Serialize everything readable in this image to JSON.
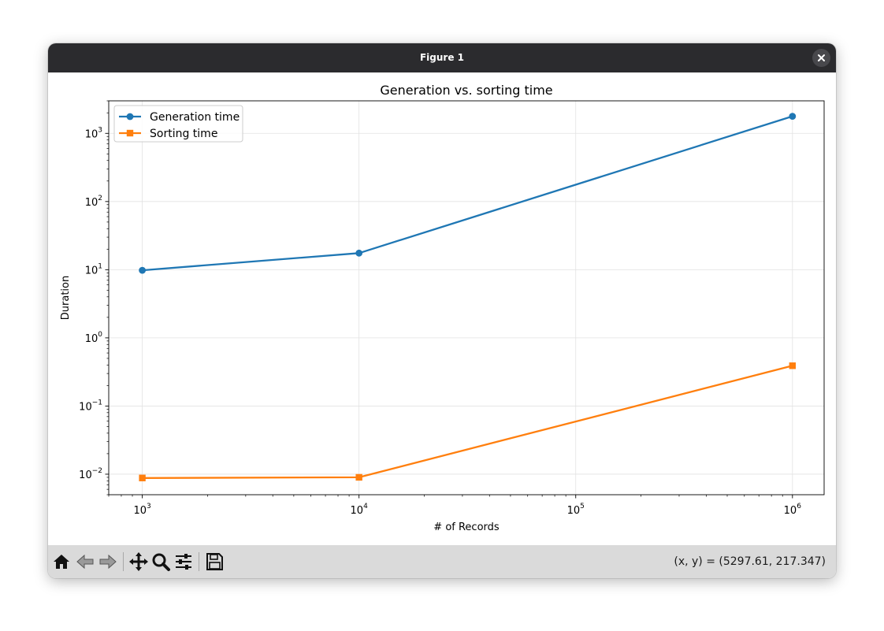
{
  "window": {
    "title": "Figure 1",
    "close_icon": "close-icon"
  },
  "toolbar": {
    "buttons": [
      {
        "name": "home-button",
        "icon": "home-icon"
      },
      {
        "name": "back-button",
        "icon": "back-arrow-icon"
      },
      {
        "name": "forward-button",
        "icon": "forward-arrow-icon"
      },
      {
        "name": "pan-button",
        "icon": "move-icon"
      },
      {
        "name": "zoom-button",
        "icon": "magnifier-icon"
      },
      {
        "name": "configure-subplots-button",
        "icon": "sliders-icon"
      },
      {
        "name": "save-button",
        "icon": "floppy-disk-icon"
      }
    ],
    "coordinates": "(x, y) = (5297.61, 217.347)"
  },
  "chart_data": {
    "type": "line",
    "title": "Generation vs. sorting time",
    "xlabel": "# of Records",
    "ylabel": "Duration",
    "xscale": "log",
    "yscale": "log",
    "xlim": [
      700,
      1400000
    ],
    "ylim": [
      0.005,
      3000
    ],
    "grid": true,
    "legend_position": "upper left",
    "x": [
      1000,
      10000,
      1000000
    ],
    "x_ticks": [
      {
        "value": 1000,
        "base": "10",
        "exp": "3"
      },
      {
        "value": 10000,
        "base": "10",
        "exp": "4"
      },
      {
        "value": 100000,
        "base": "10",
        "exp": "5"
      },
      {
        "value": 1000000,
        "base": "10",
        "exp": "6"
      }
    ],
    "y_ticks": [
      {
        "value": 0.01,
        "base": "10",
        "exp": "−2"
      },
      {
        "value": 0.1,
        "base": "10",
        "exp": "−1"
      },
      {
        "value": 1,
        "base": "10",
        "exp": "0"
      },
      {
        "value": 10,
        "base": "10",
        "exp": "1"
      },
      {
        "value": 100,
        "base": "10",
        "exp": "2"
      },
      {
        "value": 1000,
        "base": "10",
        "exp": "3"
      }
    ],
    "series": [
      {
        "name": "Generation time",
        "color": "#1f77b4",
        "marker": "circle",
        "values": [
          9.8,
          17.5,
          1780
        ]
      },
      {
        "name": "Sorting time",
        "color": "#ff7f0e",
        "marker": "square",
        "values": [
          0.0088,
          0.009,
          0.39
        ]
      }
    ]
  }
}
